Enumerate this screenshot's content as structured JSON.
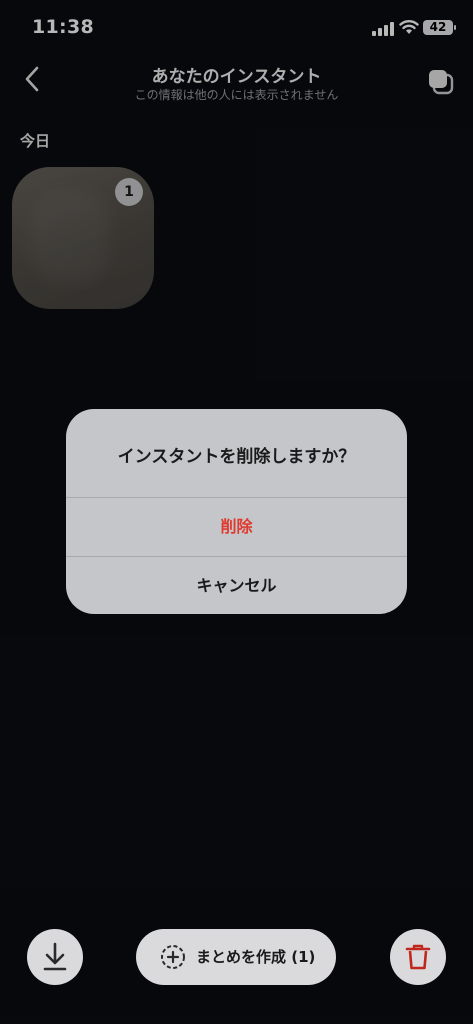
{
  "status_bar": {
    "time": "11:38",
    "battery": "42"
  },
  "header": {
    "title": "あなたのインスタント",
    "subtitle": "この情報は他の人には表示されません"
  },
  "section": {
    "label": "今日"
  },
  "thumbnail": {
    "count": "1"
  },
  "dialog": {
    "title": "インスタントを削除しますか？",
    "delete_label": "削除",
    "cancel_label": "キャンセル"
  },
  "bottom_bar": {
    "create_summary_label": "まとめを作成 (1)"
  },
  "colors": {
    "danger": "#e03a2e",
    "background": "#0b0c10"
  }
}
